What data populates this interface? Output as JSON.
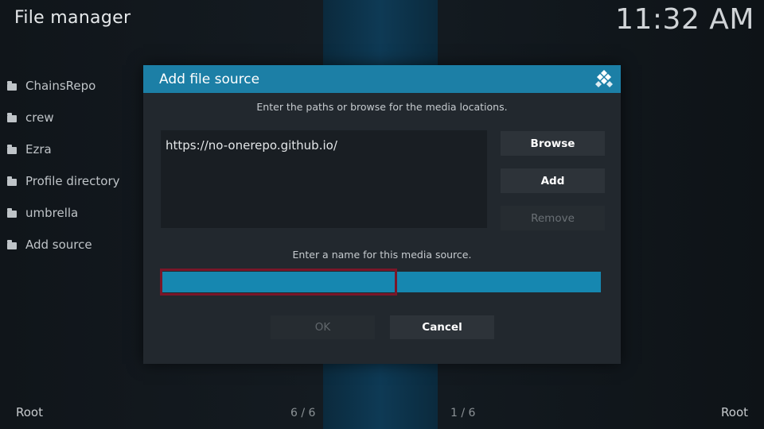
{
  "app": {
    "title": "File manager",
    "clock": "11:32 AM"
  },
  "sidebar": {
    "items": [
      {
        "label": "ChainsRepo",
        "icon": "folder-icon"
      },
      {
        "label": "crew",
        "icon": "folder-icon"
      },
      {
        "label": "Ezra",
        "icon": "folder-icon"
      },
      {
        "label": "Profile directory",
        "icon": "folder-icon"
      },
      {
        "label": "umbrella",
        "icon": "folder-icon"
      },
      {
        "label": "Add source",
        "icon": "folder-icon"
      }
    ]
  },
  "footer": {
    "left_label": "Root",
    "left_count": "6 / 6",
    "right_count": "1 / 6",
    "right_label": "Root"
  },
  "dialog": {
    "title": "Add file source",
    "logo_icon": "kodi-logo-icon",
    "paths_hint": "Enter the paths or browse for the media locations.",
    "path_value": "https://no-onerepo.github.io/",
    "buttons": {
      "browse": "Browse",
      "add": "Add",
      "remove": "Remove"
    },
    "name_hint": "Enter a name for this media source.",
    "name_value": "",
    "ok_label": "OK",
    "cancel_label": "Cancel"
  },
  "colors": {
    "accent": "#1c7fa6",
    "name_field": "#1687b0",
    "highlight_border": "#7a1628",
    "dialog_bg": "#22282e"
  }
}
